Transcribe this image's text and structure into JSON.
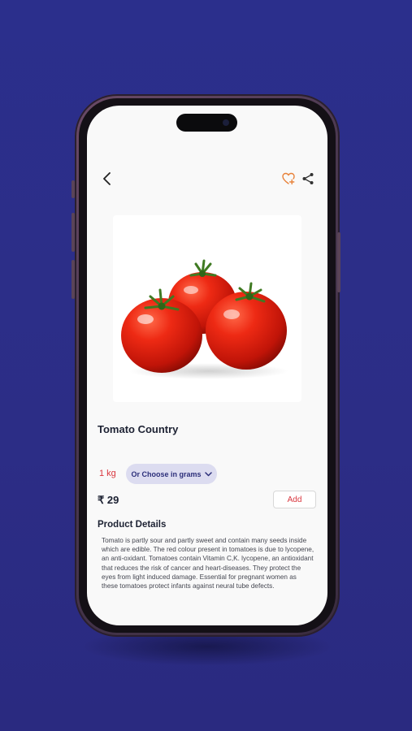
{
  "product": {
    "name": "Tomato Country",
    "weight": "1 kg",
    "grams_option": "Or Choose in grams",
    "price": "₹ 29",
    "add_label": "Add"
  },
  "details": {
    "heading": "Product Details",
    "description": "Tomato is partly sour and partly sweet and contain many seeds inside which are edible. The red colour present in tomatoes is due to lycopene, an anti-oxidant. Tomatoes contain Vitamin C,K. lycopene, an antioxidant that reduces the risk of cancer and heart-diseases. They protect the eyes from light induced damage. Essential for pregnant women as these tomatoes protect infants against neural tube defects."
  },
  "icons": {
    "back": "back-arrow-icon",
    "favorite": "heart-add-icon",
    "share": "share-icon",
    "dropdown": "chevron-down-icon"
  },
  "colors": {
    "background": "#2b2f8c",
    "accent_red": "#d9363e",
    "favorite_orange": "#e8823a",
    "chip_bg": "#dcdcf0"
  }
}
